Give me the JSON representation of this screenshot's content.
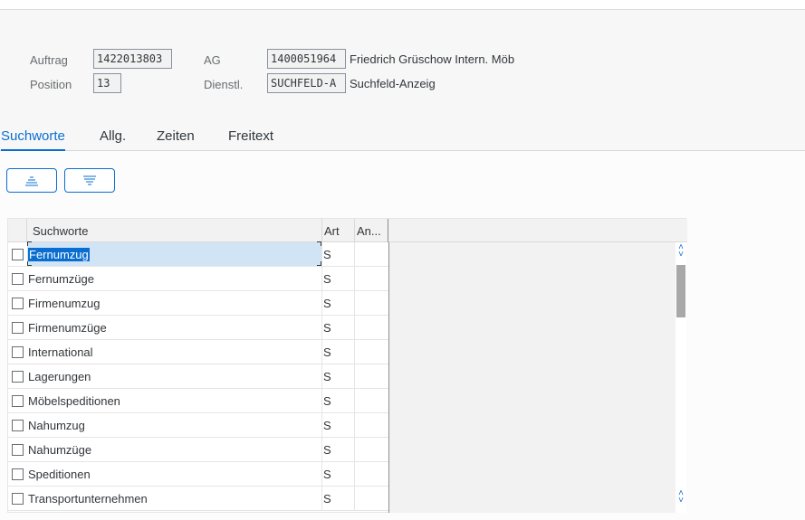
{
  "header": {
    "auftrag_label": "Auftrag",
    "auftrag_value": "1422013803",
    "position_label": "Position",
    "position_value": "13",
    "ag_label": "AG",
    "ag_value": "1400051964",
    "ag_desc": "Friedrich Grüschow Intern. Möb",
    "dienstl_label": "Dienstl.",
    "dienstl_value": "SUCHFELD-A",
    "dienstl_desc": "Suchfeld-Anzeig"
  },
  "tabs": [
    {
      "label": "Suchworte",
      "active": true
    },
    {
      "label": "Allg.",
      "active": false
    },
    {
      "label": "Zeiten",
      "active": false
    },
    {
      "label": "Freitext",
      "active": false
    }
  ],
  "toolbar": {
    "sort_ascending_icon": "sort-ascending-icon",
    "sort_descending_icon": "sort-descending-icon"
  },
  "table": {
    "columns": [
      "Suchworte",
      "Art",
      "An..."
    ],
    "rows": [
      {
        "suchwort": "Fernumzug",
        "art": "S",
        "an": ""
      },
      {
        "suchwort": "Fernumzüge",
        "art": "S",
        "an": ""
      },
      {
        "suchwort": "Firmenumzug",
        "art": "S",
        "an": ""
      },
      {
        "suchwort": "Firmenumzüge",
        "art": "S",
        "an": ""
      },
      {
        "suchwort": "International",
        "art": "S",
        "an": ""
      },
      {
        "suchwort": "Lagerungen",
        "art": "S",
        "an": ""
      },
      {
        "suchwort": "Möbelspeditionen",
        "art": "S",
        "an": ""
      },
      {
        "suchwort": "Nahumzug",
        "art": "S",
        "an": ""
      },
      {
        "suchwort": "Nahumzüge",
        "art": "S",
        "an": ""
      },
      {
        "suchwort": "Speditionen",
        "art": "S",
        "an": ""
      },
      {
        "suchwort": "Transportunternehmen",
        "art": "S",
        "an": ""
      }
    ]
  },
  "colors": {
    "accent": "#0a6ed1",
    "selection": "#d1e4f5"
  }
}
